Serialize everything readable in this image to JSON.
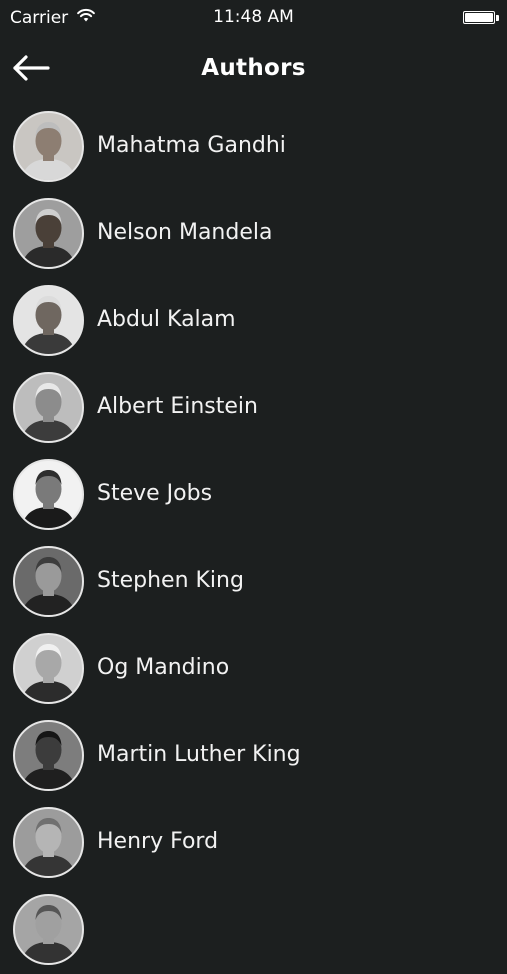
{
  "status_bar": {
    "carrier": "Carrier",
    "time": "11:48 AM",
    "battery_level": 1.0
  },
  "nav": {
    "title": "Authors",
    "back_icon": "arrow-left-icon"
  },
  "authors": [
    {
      "name": "Mahatma Gandhi",
      "avatar_bg": "#c9c6c2",
      "skin": "#8d7e72",
      "shirt": "#d8d8d8",
      "hair": "#bdbdbd"
    },
    {
      "name": "Nelson Mandela",
      "avatar_bg": "#9e9e9e",
      "skin": "#4a4038",
      "shirt": "#2a2a2a",
      "hair": "#cfcfcf"
    },
    {
      "name": "Abdul Kalam",
      "avatar_bg": "#e4e4e4",
      "skin": "#6f6760",
      "shirt": "#3a3a3a",
      "hair": "#dcdcdc"
    },
    {
      "name": "Albert Einstein",
      "avatar_bg": "#bdbdbd",
      "skin": "#8c8c8c",
      "shirt": "#3c3c3c",
      "hair": "#e8e8e8"
    },
    {
      "name": "Steve Jobs",
      "avatar_bg": "#f2f2f2",
      "skin": "#7a7a7a",
      "shirt": "#1a1a1a",
      "hair": "#2e2e2e"
    },
    {
      "name": "Stephen King",
      "avatar_bg": "#6a6a6a",
      "skin": "#9a9a9a",
      "shirt": "#222222",
      "hair": "#3d3d3d"
    },
    {
      "name": "Og Mandino",
      "avatar_bg": "#d0d0d0",
      "skin": "#a8a8a8",
      "shirt": "#2c2c2c",
      "hair": "#f0f0f0"
    },
    {
      "name": "Martin Luther King",
      "avatar_bg": "#7d7d7d",
      "skin": "#3c3c3c",
      "shirt": "#1f1f1f",
      "hair": "#151515"
    },
    {
      "name": "Henry Ford",
      "avatar_bg": "#9c9c9c",
      "skin": "#b5b5b5",
      "shirt": "#353535",
      "hair": "#707070"
    },
    {
      "name": "",
      "avatar_bg": "#a5a5a5",
      "skin": "#a0a0a0",
      "shirt": "#333333",
      "hair": "#555555"
    }
  ]
}
